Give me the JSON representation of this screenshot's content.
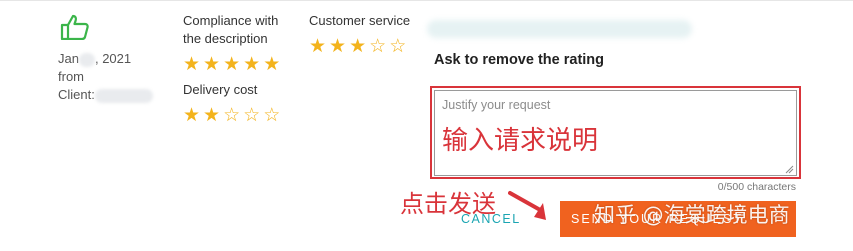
{
  "review": {
    "date_prefix": "Jan",
    "date_suffix": ", 2021",
    "from_label": "from",
    "client_label": "Client:"
  },
  "criteria": [
    {
      "label": "Compliance with the description",
      "rating": 5,
      "max": 5
    },
    {
      "label": "Delivery cost",
      "rating": 2,
      "max": 5
    },
    {
      "label": "Customer service",
      "rating": 3,
      "max": 5
    }
  ],
  "remove_rating": {
    "title": "Ask to remove the rating",
    "placeholder": "Justify your request",
    "char_count": "0/500 characters",
    "cancel_label": "CANCEL",
    "send_label": "SEND YOUR REQUEST"
  },
  "annotations": {
    "input_hint": "输入请求说明",
    "send_hint": "点击发送"
  },
  "watermark": "知乎 @海棠跨境电商",
  "colors": {
    "star": "#f3b31c",
    "thumb": "#3bb54a",
    "accent_teal": "#1aa5b2",
    "send_button": "#f0621f",
    "annotation_red": "#d9343a"
  },
  "icons": {
    "thumb": "thumbs-up-outline",
    "star": "star",
    "arrow": "arrow-right"
  }
}
